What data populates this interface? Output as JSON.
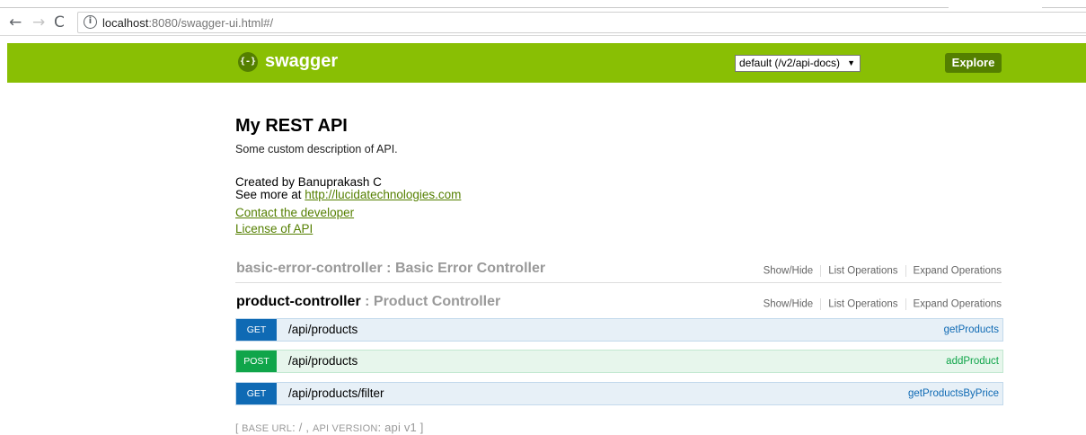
{
  "browser": {
    "back_icon": "←",
    "forward_icon": "→",
    "reload_icon": "C",
    "info_icon": "i",
    "url_host": "localhost",
    "url_path": ":8080/swagger-ui.html#/"
  },
  "header": {
    "logo_glyph": "{-}",
    "title": "swagger",
    "spec_select": "default (/v2/api-docs)",
    "caret": "▼",
    "explore_label": "Explore",
    "color": "#89bf04"
  },
  "info": {
    "title": "My REST API",
    "description": "Some custom description of API.",
    "created_by": "Created by Banuprakash C",
    "see_more_prefix": "See more at ",
    "see_more_link": "http://lucidatechnologies.com",
    "contact_link": "Contact the developer",
    "license_link": "License of API"
  },
  "controllers": [
    {
      "name": "basic-error-controller",
      "description": " : Basic Error Controller",
      "ops": [
        "Show/Hide",
        "List Operations",
        "Expand Operations"
      ]
    },
    {
      "name": "product-controller",
      "description": " : Product Controller",
      "ops": [
        "Show/Hide",
        "List Operations",
        "Expand Operations"
      ]
    }
  ],
  "operations": [
    {
      "method": "GET",
      "path": "/api/products",
      "nickname": "getProducts"
    },
    {
      "method": "POST",
      "path": "/api/products",
      "nickname": "addProduct"
    },
    {
      "method": "GET",
      "path": "/api/products/filter",
      "nickname": "getProductsByPrice"
    }
  ],
  "footer": {
    "open": "[ ",
    "base_url_label": "BASE URL",
    "base_url_value": ": / , ",
    "api_version_label": "API VERSION",
    "api_version_value": ": api v1 ]"
  }
}
